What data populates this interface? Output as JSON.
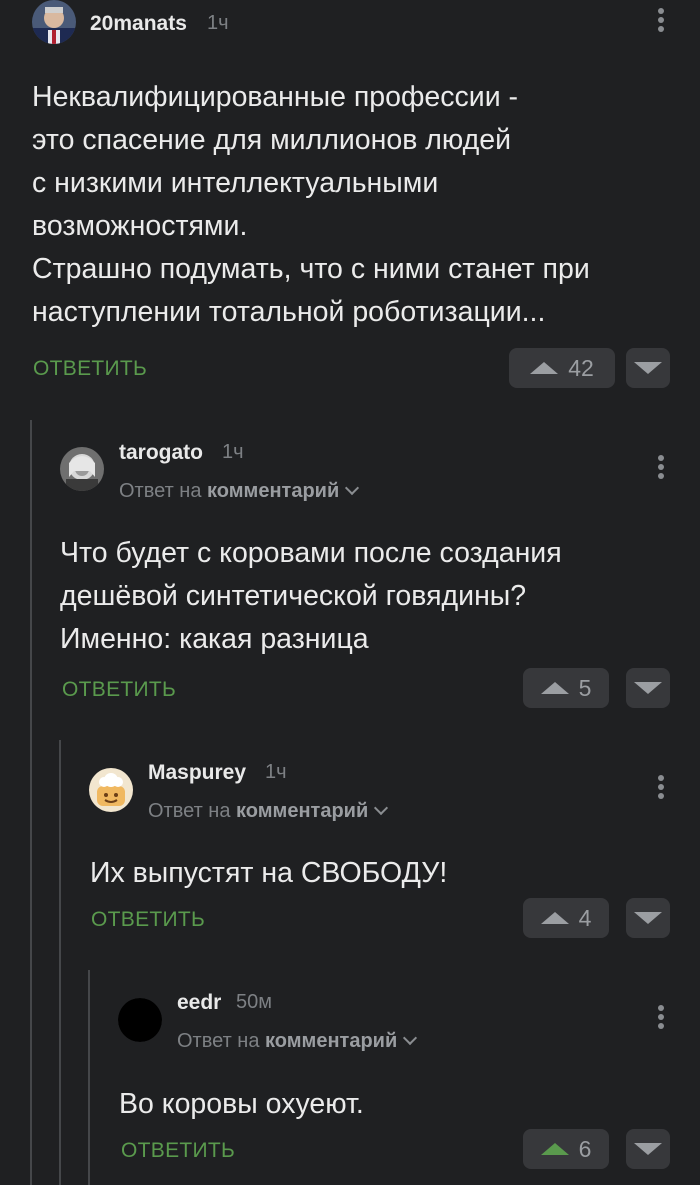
{
  "comments": [
    {
      "username": "20manats",
      "time": "1ч",
      "body": [
        "Неквалифицированные профессии -",
        "это спасение для миллионов людей",
        "с низкими интеллектуальными",
        "возможностями.",
        "Страшно подумать, что с ними станет при",
        "наступлении тотальной роботизации..."
      ],
      "reply_label": "ОТВЕТИТЬ",
      "votes": "42",
      "upvoted": false
    },
    {
      "username": "tarogato",
      "time": "1ч",
      "reply_to_prefix": "Ответ на",
      "reply_to_target": "комментарий",
      "body": [
        "Что будет с коровами после создания",
        "дешёвой синтетической говядины?",
        "Именно: какая разница"
      ],
      "reply_label": "ОТВЕТИТЬ",
      "votes": "5",
      "upvoted": false
    },
    {
      "username": "Maspurey",
      "time": "1ч",
      "reply_to_prefix": "Ответ на",
      "reply_to_target": "комментарий",
      "body": [
        "Их выпустят на СВОБОДУ!"
      ],
      "reply_label": "ОТВЕТИТЬ",
      "votes": "4",
      "upvoted": false
    },
    {
      "username": "eedr",
      "time": "50м",
      "reply_to_prefix": "Ответ на",
      "reply_to_target": "комментарий",
      "body": [
        "Во коровы охуеют."
      ],
      "reply_label": "ОТВЕТИТЬ",
      "votes": "6",
      "upvoted": true
    }
  ],
  "colors": {
    "background": "#1f2022",
    "accent_green": "#5a9a4d",
    "muted_text": "#7d8084",
    "button_bg": "#37383b"
  },
  "icons": {
    "more": "more-vertical-icon",
    "upvote": "upvote-arrow-icon",
    "downvote": "downvote-arrow-icon",
    "expand": "chevron-down-icon"
  }
}
